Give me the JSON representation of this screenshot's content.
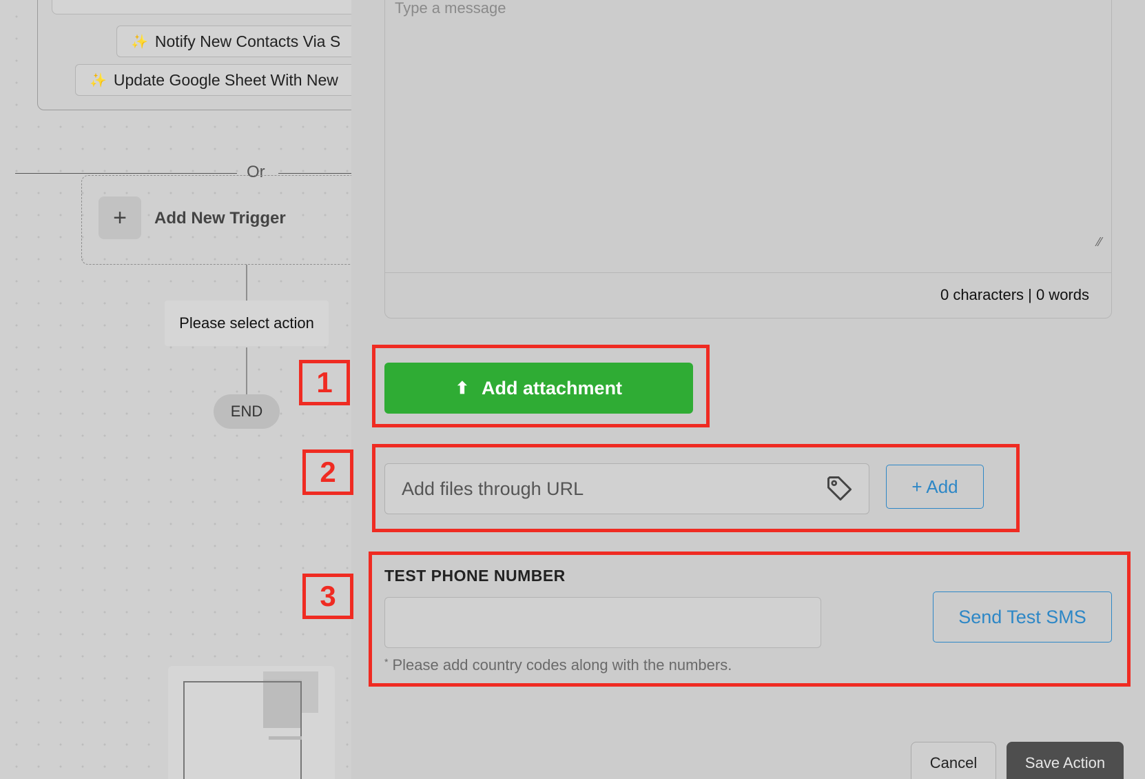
{
  "canvas": {
    "suggestions": [
      {
        "label": "Notify New Contacts Via S"
      },
      {
        "label": "Update Google Sheet With New"
      }
    ],
    "or_text": "Or",
    "add_trigger_label": "Add New Trigger",
    "add_trigger_plus": "+",
    "select_action_label": "Please select action",
    "end_label": "END"
  },
  "message": {
    "placeholder": "Type a message",
    "counter": "0 characters | 0 words"
  },
  "attachment": {
    "button_label": "Add attachment"
  },
  "url_files": {
    "placeholder": "Add files through URL",
    "add_label": "+ Add"
  },
  "test_phone": {
    "label": "TEST PHONE NUMBER",
    "value": "",
    "hint_marker": "*",
    "hint": "Please add country codes along with the numbers.",
    "send_label": "Send Test SMS"
  },
  "footer": {
    "cancel_label": "Cancel",
    "save_label": "Save Action"
  },
  "annotations": [
    "1",
    "2",
    "3"
  ],
  "colors": {
    "attach_green": "#2fac34",
    "link_blue": "#2d87c6",
    "annotation_red": "#ef2b22",
    "save_dark": "#4e4e4e"
  }
}
